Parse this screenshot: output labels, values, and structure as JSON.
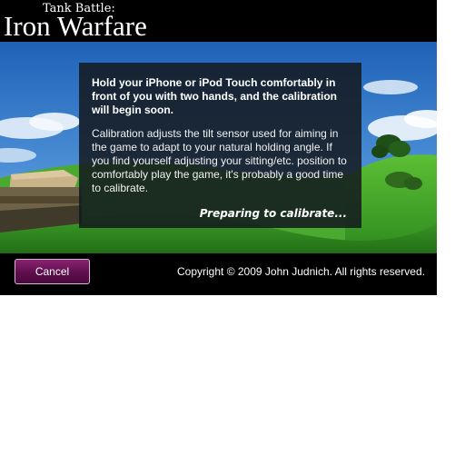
{
  "header": {
    "subtitle": "Tank Battle:",
    "title": "Iron Warfare"
  },
  "calibration": {
    "lead": "Hold your iPhone or iPod Touch comfortably in front of you with two hands, and the calibration will begin soon.",
    "body": "Calibration adjusts the tilt sensor used for aiming in the game to adapt to your natural holding angle. If you find yourself adjusting your sitting/etc. position to comfortably play the game, it's probably a good time to calibrate.",
    "status": "Preparing to calibrate..."
  },
  "footer": {
    "cancel_label": "Cancel",
    "copyright": "Copyright © 2009 John Judnich. All rights reserved."
  },
  "colors": {
    "accent": "#5e0e4e",
    "sky": "#2f78c8",
    "grass": "#3fa02a"
  }
}
